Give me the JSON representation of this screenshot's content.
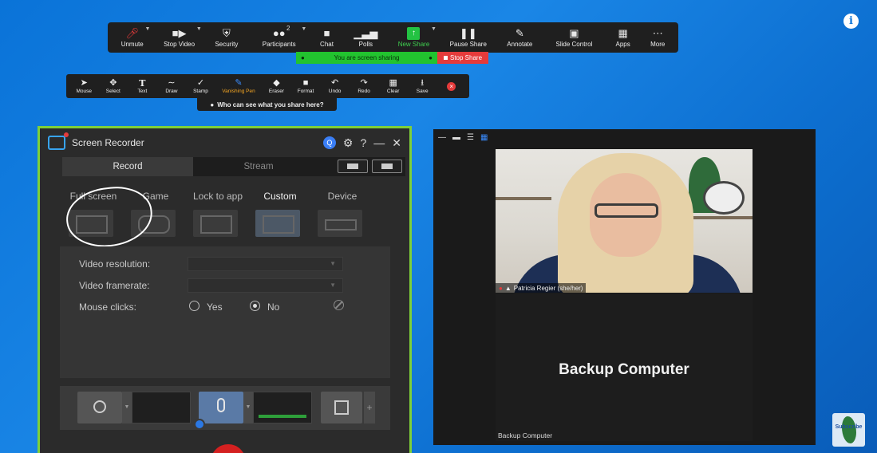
{
  "zoom_toolbar": {
    "items": [
      {
        "id": "unmute",
        "label": "Unmute",
        "icon": "mic-muted-icon"
      },
      {
        "id": "stop-video",
        "label": "Stop Video",
        "icon": "video-camera-icon"
      },
      {
        "id": "security",
        "label": "Security",
        "icon": "shield-icon"
      },
      {
        "id": "participants",
        "label": "Participants",
        "icon": "people-icon",
        "count": "2"
      },
      {
        "id": "chat",
        "label": "Chat",
        "icon": "chat-bubble-icon"
      },
      {
        "id": "polls",
        "label": "Polls",
        "icon": "bar-chart-icon"
      },
      {
        "id": "new-share",
        "label": "New Share",
        "icon": "share-arrow-icon"
      },
      {
        "id": "pause-share",
        "label": "Pause Share",
        "icon": "pause-icon"
      },
      {
        "id": "annotate",
        "label": "Annotate",
        "icon": "pen-icon"
      },
      {
        "id": "slide-control",
        "label": "Slide Control",
        "icon": "slide-icon"
      },
      {
        "id": "apps",
        "label": "Apps",
        "icon": "apps-icon"
      },
      {
        "id": "more",
        "label": "More",
        "icon": "more-dots-icon"
      }
    ],
    "sharing_status": "You are screen sharing",
    "stop_share": "Stop Share"
  },
  "annotate_toolbar": {
    "items": [
      {
        "label": "Mouse",
        "icon": "cursor-icon"
      },
      {
        "label": "Select",
        "icon": "move-icon"
      },
      {
        "label": "Text",
        "icon": "text-icon"
      },
      {
        "label": "Draw",
        "icon": "draw-icon"
      },
      {
        "label": "Stamp",
        "icon": "check-icon"
      },
      {
        "label": "Vanishing Pen",
        "icon": "pen-icon",
        "active": true
      },
      {
        "label": "Eraser",
        "icon": "eraser-icon"
      },
      {
        "label": "Format",
        "icon": "format-icon"
      },
      {
        "label": "Undo",
        "icon": "undo-icon"
      },
      {
        "label": "Redo",
        "icon": "redo-icon"
      },
      {
        "label": "Clear",
        "icon": "trash-icon"
      },
      {
        "label": "Save",
        "icon": "save-icon"
      }
    ],
    "who_can_see": "Who can see what you share here?"
  },
  "recorder": {
    "title": "Screen Recorder",
    "badge": "Q",
    "tabs": [
      "Record",
      "Stream"
    ],
    "modes": [
      "Full screen",
      "Game",
      "Lock to app",
      "Custom",
      "Device"
    ],
    "active_mode": "Custom",
    "settings": {
      "video_resolution_label": "Video resolution:",
      "video_framerate_label": "Video framerate:",
      "mouse_clicks_label": "Mouse clicks:",
      "yes": "Yes",
      "no": "No"
    }
  },
  "video_panel": {
    "participant_name": "Patricia Regier (she/her)",
    "backup_title": "Backup Computer",
    "backup_label": "Backup Computer"
  },
  "subscribe": "Subscribe",
  "colors": {
    "desktop": "#0a73d8",
    "recorder_border": "#7ed03a",
    "share_green": "#22c32f",
    "stop_red": "#e53b3b"
  }
}
